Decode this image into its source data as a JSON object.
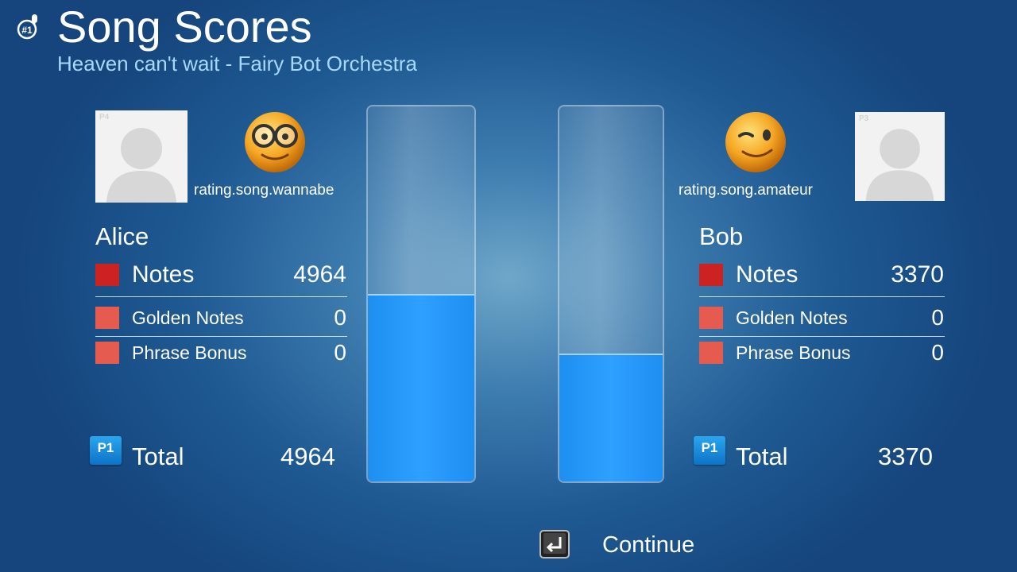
{
  "header": {
    "title": "Song Scores",
    "subtitle": "Heaven can't wait - Fairy Bot Orchestra",
    "icon": "karaoke-mic-icon"
  },
  "players": [
    {
      "avatar_tag": "P4",
      "rating": "rating.song.wannabe",
      "smiley": "nerd-glasses-smiley",
      "name": "Alice",
      "notes_label": "Notes",
      "notes_value": "4964",
      "golden_label": "Golden Notes",
      "golden_value": "0",
      "phrase_label": "Phrase Bonus",
      "phrase_value": "0",
      "badge": "P1",
      "total_label": "Total",
      "total_value": "4964",
      "bar_fraction": 0.496
    },
    {
      "avatar_tag": "P3",
      "rating": "rating.song.amateur",
      "smiley": "winking-smiley",
      "name": "Bob",
      "notes_label": "Notes",
      "notes_value": "3370",
      "golden_label": "Golden Notes",
      "golden_value": "0",
      "phrase_label": "Phrase Bonus",
      "phrase_value": "0",
      "badge": "P1",
      "total_label": "Total",
      "total_value": "3370",
      "bar_fraction": 0.337
    }
  ],
  "footer": {
    "continue_label": "Continue",
    "continue_icon": "enter-key-icon"
  },
  "colors": {
    "notes_marker": "#cc2222",
    "bonus_marker": "#e65b4f",
    "bar_fill": "#2196f3",
    "subtitle": "#a8d8ff"
  }
}
